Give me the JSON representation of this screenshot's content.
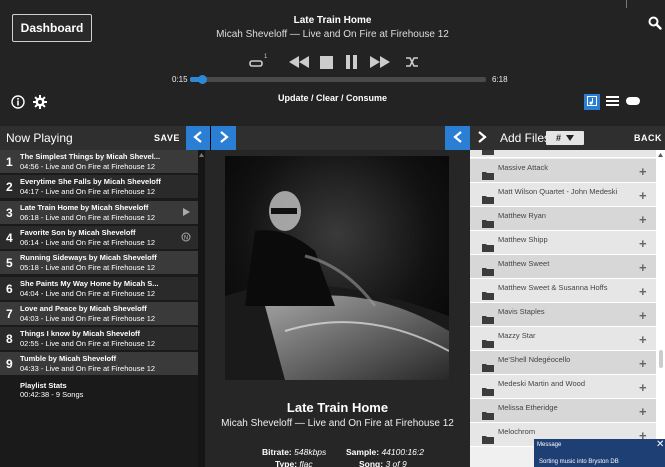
{
  "header": {
    "dashboard_label": "Dashboard",
    "track_title": "Late Train Home",
    "track_subtitle": "Micah Sheveloff — Live and On Fire at Firehouse 12",
    "time_elapsed": "0:15",
    "time_total": "6:18",
    "progress_fraction": 0.04,
    "update_clear_consume": "Update / Clear / Consume",
    "repeat_badge": "1"
  },
  "colors": {
    "accent": "#2a7fd4",
    "header_bg": "#232323",
    "panel_bg": "#262626"
  },
  "now_playing": {
    "title": "Now Playing",
    "save_label": "SAVE",
    "tracks": [
      {
        "num": "1",
        "line1": "The Simplest Things by Micah Shevel...",
        "line2": "04:56 - Live and On Fire at Firehouse 12",
        "indicator": ""
      },
      {
        "num": "2",
        "line1": "Everytime She Falls by Micah Sheveloff",
        "line2": "04:17 - Live and On Fire at Firehouse 12",
        "indicator": ""
      },
      {
        "num": "3",
        "line1": "Late Train Home by Micah Sheveloff",
        "line2": "06:18 - Live and On Fire at Firehouse 12",
        "indicator": "play-indicator-icon"
      },
      {
        "num": "4",
        "line1": "Favorite Son by Micah Sheveloff",
        "line2": "06:14 - Live and On Fire at Firehouse 12",
        "indicator": "next-indicator-icon"
      },
      {
        "num": "5",
        "line1": "Running Sideways by Micah Sheveloff",
        "line2": "05:18 - Live and On Fire at Firehouse 12",
        "indicator": ""
      },
      {
        "num": "6",
        "line1": "She Paints My Way Home by Micah S...",
        "line2": "04:04 - Live and On Fire at Firehouse 12",
        "indicator": ""
      },
      {
        "num": "7",
        "line1": "Love and Peace by Micah Sheveloff",
        "line2": "04:03 - Live and On Fire at Firehouse 12",
        "indicator": ""
      },
      {
        "num": "8",
        "line1": "Things I know by Micah Sheveloff",
        "line2": "02:55 - Live and On Fire at Firehouse 12",
        "indicator": ""
      },
      {
        "num": "9",
        "line1": "Tumble by Micah Sheveloff",
        "line2": "04:33 - Live and On Fire at Firehouse 12",
        "indicator": ""
      }
    ],
    "stats_title": "Playlist Stats",
    "stats_detail": "00:42:38 - 9 Songs"
  },
  "center": {
    "title": "Late Train Home",
    "subtitle": "Micah Sheveloff — Live and On Fire at Firehouse 12",
    "bitrate_label": "Bitrate:",
    "bitrate_value": "548kbps",
    "sample_label": "Sample:",
    "sample_value": "44100:16:2",
    "type_label": "Type:",
    "type_value": "flac",
    "song_label": "Song:",
    "song_value": "3 of 9"
  },
  "add_files": {
    "title": "Add Files",
    "filter_label": "#",
    "back_label": "BACK",
    "items": [
      "",
      "Massive Attack",
      "Matt Wilson Quartet - John Medeski",
      "Matthew Ryan",
      "Matthew Shipp",
      "Matthew Sweet",
      "Matthew Sweet & Susanna Hoffs",
      "Mavis Staples",
      "Mazzy Star",
      "Me'Shell Ndegéocello",
      "Medeski Martin and Wood",
      "Melissa Etheridge",
      "Melochrom"
    ]
  },
  "message": {
    "title": "Message",
    "body": "Sorting music into Bryston DB"
  }
}
